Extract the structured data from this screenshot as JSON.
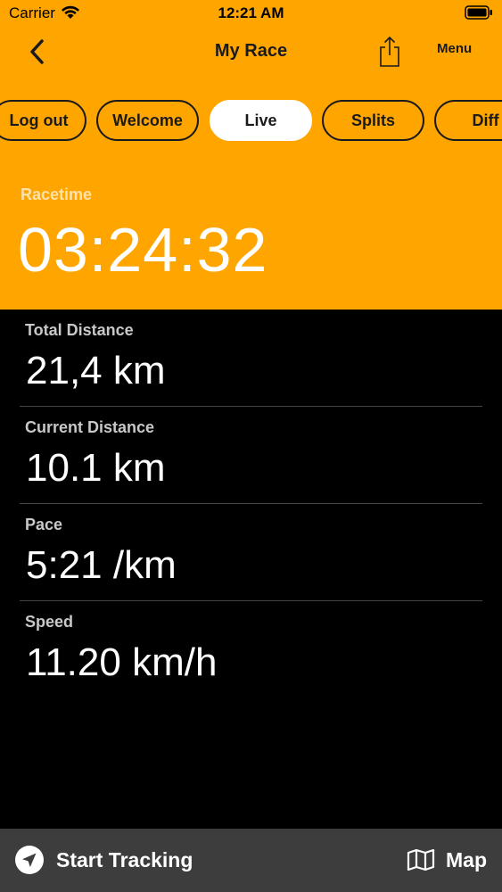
{
  "status_bar": {
    "carrier": "Carrier",
    "time": "12:21 AM"
  },
  "nav": {
    "title": "My Race",
    "menu_label": "Menu",
    "back_icon": "chevron-left-icon",
    "share_icon": "share-icon"
  },
  "tabs": [
    {
      "label": "Log out",
      "active": false
    },
    {
      "label": "Welcome",
      "active": false
    },
    {
      "label": "Live",
      "active": true
    },
    {
      "label": "Splits",
      "active": false
    },
    {
      "label": "Diff",
      "active": false
    }
  ],
  "racetime": {
    "label": "Racetime",
    "value": "03:24:32"
  },
  "stats": [
    {
      "label": "Total Distance",
      "value": "21,4 km"
    },
    {
      "label": "Current Distance",
      "value": "10.1 km"
    },
    {
      "label": "Pace",
      "value": "5:21 /km"
    },
    {
      "label": "Speed",
      "value": "11.20 km/h"
    }
  ],
  "bottom_bar": {
    "start_tracking_label": "Start Tracking",
    "map_label": "Map"
  },
  "colors": {
    "accent": "#FFA500",
    "background": "#000000",
    "bottom_bar": "#3D3D3D",
    "active_tab": "#FFFFFF"
  }
}
